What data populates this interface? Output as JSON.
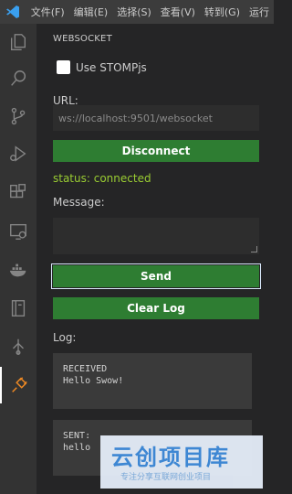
{
  "menu": [
    "文件(F)",
    "编辑(E)",
    "选择(S)",
    "查看(V)",
    "转到(G)",
    "运行"
  ],
  "activity_bar": [
    "explorer-icon",
    "search-icon",
    "source-control-icon",
    "run-debug-icon",
    "extensions-icon",
    "remote-explorer-icon",
    "docker-icon",
    "notebook-icon",
    "timeline-icon",
    "plug-icon"
  ],
  "panel": {
    "title": "WEBSOCKET",
    "stomp_label": "Use STOMPjs",
    "url_label": "URL:",
    "url_value": "ws://localhost:9501/websocket",
    "disconnect_label": "Disconnect",
    "status_text": "status: connected",
    "message_label": "Message:",
    "message_value": "",
    "send_label": "Send",
    "clear_label": "Clear Log",
    "log_label": "Log:",
    "log": [
      {
        "line1": "RECEIVED",
        "line2": "Hello Swow!"
      },
      {
        "line1": "SENT:",
        "line2": "hello"
      }
    ]
  },
  "watermark": {
    "title": "云创项目库",
    "subtitle": "专注分享互联网创业项目"
  },
  "colors": {
    "accent_button": "#2e7d32",
    "status": "#9acd32",
    "activity_bar": "#333333",
    "sidebar": "#252526"
  }
}
